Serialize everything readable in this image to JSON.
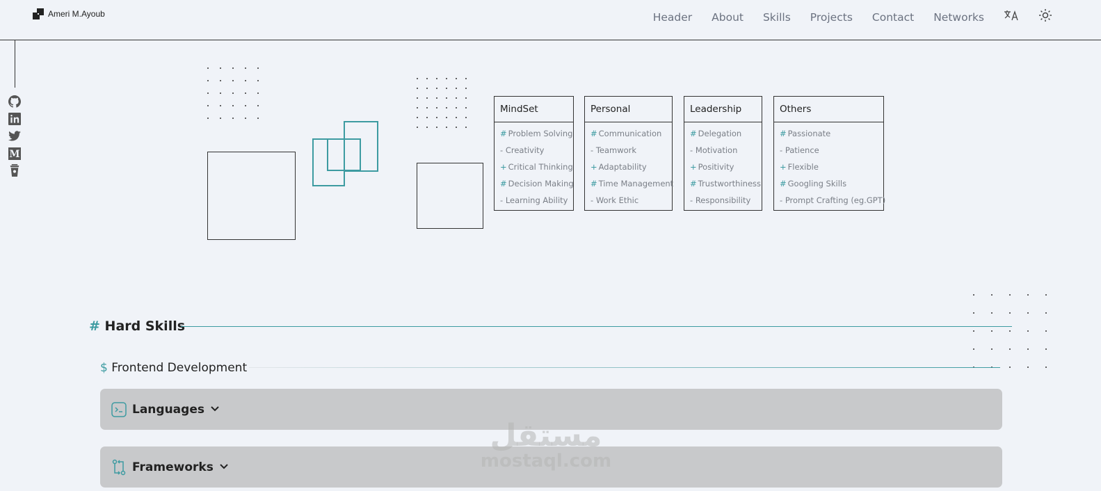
{
  "brand": {
    "name": "Ameri M.Ayoub",
    "logo_icon": "brand-logo-icon"
  },
  "nav": {
    "items": [
      "Header",
      "About",
      "Skills",
      "Projects",
      "Contact",
      "Networks"
    ],
    "translate_icon": "translate-icon",
    "theme_icon": "sun-icon"
  },
  "social": [
    "github-icon",
    "linkedin-icon",
    "twitter-icon",
    "medium-icon",
    "buymeacoffee-icon"
  ],
  "soft_skills": [
    {
      "title": "MindSet",
      "items": [
        {
          "prefix": "#",
          "label": "Problem Solving"
        },
        {
          "prefix": "-",
          "label": "Creativity"
        },
        {
          "prefix": "+",
          "label": "Critical Thinking"
        },
        {
          "prefix": "#",
          "label": "Decision Making"
        },
        {
          "prefix": "-",
          "label": "Learning Ability"
        }
      ]
    },
    {
      "title": "Personal",
      "items": [
        {
          "prefix": "#",
          "label": "Communication"
        },
        {
          "prefix": "-",
          "label": "Teamwork"
        },
        {
          "prefix": "+",
          "label": "Adaptability"
        },
        {
          "prefix": "#",
          "label": "Time Management"
        },
        {
          "prefix": "-",
          "label": "Work Ethic"
        }
      ]
    },
    {
      "title": "Leadership",
      "items": [
        {
          "prefix": "#",
          "label": "Delegation"
        },
        {
          "prefix": "-",
          "label": "Motivation"
        },
        {
          "prefix": "+",
          "label": "Positivity"
        },
        {
          "prefix": "#",
          "label": "Trustworthiness"
        },
        {
          "prefix": "-",
          "label": "Responsibility"
        }
      ]
    },
    {
      "title": "Others",
      "items": [
        {
          "prefix": "#",
          "label": "Passionate"
        },
        {
          "prefix": "-",
          "label": "Patience"
        },
        {
          "prefix": "+",
          "label": "Flexible"
        },
        {
          "prefix": "#",
          "label": "Googling Skills"
        },
        {
          "prefix": "-",
          "label": "Prompt Crafting (eg.GPT)"
        }
      ]
    }
  ],
  "hard_skills": {
    "prefix": "#",
    "title": "Hard Skills",
    "section": {
      "prefix": "$",
      "title": "Frontend Development"
    },
    "accordions": [
      {
        "label": "Languages",
        "icon": "terminal-icon"
      },
      {
        "label": "Frameworks",
        "icon": "git-compare-icon"
      }
    ]
  },
  "watermark": {
    "arabic": "مستقل",
    "latin": "mostaql.com"
  },
  "colors": {
    "accent": "#3d9ba1",
    "background": "#f0f3f8",
    "accordion": "#c8c9cb"
  }
}
